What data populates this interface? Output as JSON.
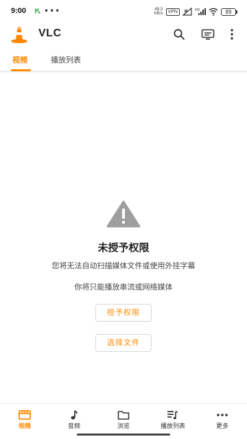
{
  "status_bar": {
    "time": "9:00",
    "notification_icon": "wechat-icon",
    "overflow_dots": "•••",
    "net_speed_value": "48.3",
    "net_speed_unit": "KB/s",
    "vpn_label": "VPN",
    "battery_level": "89"
  },
  "app_bar": {
    "title": "VLC",
    "search_icon": "search-icon",
    "cast_icon": "renderer-icon",
    "menu_icon": "more-vertical-icon"
  },
  "tabs": [
    {
      "label": "视频",
      "active": true
    },
    {
      "label": "播放列表",
      "active": false
    }
  ],
  "empty_state": {
    "icon": "warning-icon",
    "title": "未授予权限",
    "line1": "您将无法自动扫描媒体文件或使用外挂字幕",
    "line2": "你将只能播放串流或网络媒体",
    "grant_button": "授予权限",
    "select_button": "选择文件"
  },
  "bottom_nav": [
    {
      "label": "视频",
      "icon": "video-icon",
      "active": true
    },
    {
      "label": "音频",
      "icon": "music-note-icon",
      "active": false
    },
    {
      "label": "浏览",
      "icon": "folder-icon",
      "active": false
    },
    {
      "label": "播放列表",
      "icon": "playlist-icon",
      "active": false
    },
    {
      "label": "更多",
      "icon": "more-horizontal-icon",
      "active": false
    }
  ],
  "colors": {
    "accent": "#ff8800",
    "warning_icon": "#9e9e9e"
  }
}
